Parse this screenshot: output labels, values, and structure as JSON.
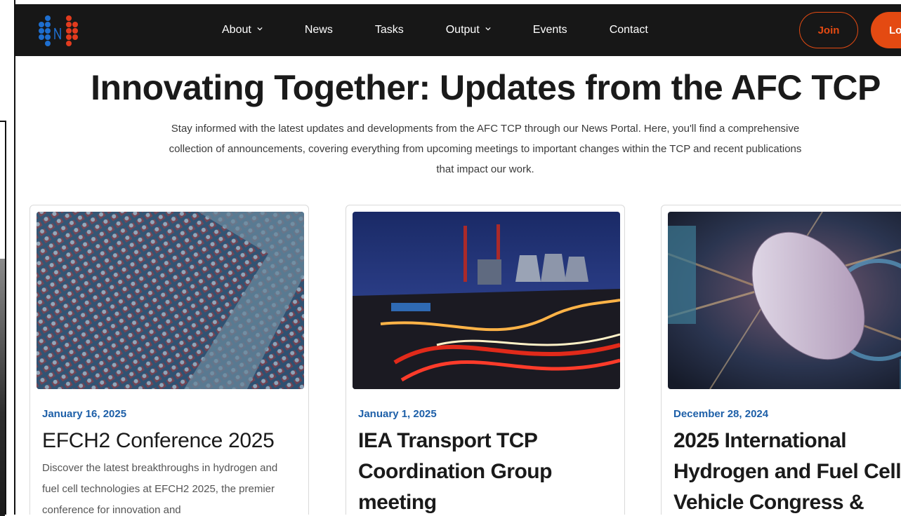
{
  "nav": {
    "items": [
      {
        "label": "About",
        "dropdown": true
      },
      {
        "label": "News",
        "dropdown": false
      },
      {
        "label": "Tasks",
        "dropdown": false
      },
      {
        "label": "Output",
        "dropdown": true
      },
      {
        "label": "Events",
        "dropdown": false
      },
      {
        "label": "Contact",
        "dropdown": false
      }
    ],
    "join_label": "Join",
    "login_label": "Lo"
  },
  "hero": {
    "title": "Innovating Together: Updates from the AFC TCP",
    "description": "Stay informed with the latest updates and developments from the AFC TCP through our News Portal. Here, you'll find a comprehensive collection of announcements, covering everything from upcoming meetings to important changes within the TCP and recent publications that impact our work."
  },
  "cards": [
    {
      "date": "January 16, 2025",
      "title": "EFCH2 Conference 2025",
      "excerpt": "Discover the latest breakthroughs in hydrogen and fuel cell technologies at EFCH2 2025, the premier conference for innovation and",
      "image": "conference-audience-photo"
    },
    {
      "date": "January 1, 2025",
      "title": "IEA Transport TCP Coordination Group meeting",
      "excerpt": "",
      "image": "power-plant-highway-night-photo"
    },
    {
      "date": "December 28, 2024",
      "title": "2025 International Hydrogen and Fuel Cell Vehicle Congress &",
      "excerpt": "",
      "image": "futuristic-city-aerial-photo"
    }
  ],
  "colors": {
    "accent": "#e44a12",
    "nav_bg": "#171717",
    "date_blue": "#1d5fa8",
    "logo_blue": "#1e6fd0",
    "logo_red": "#e23b1e"
  }
}
